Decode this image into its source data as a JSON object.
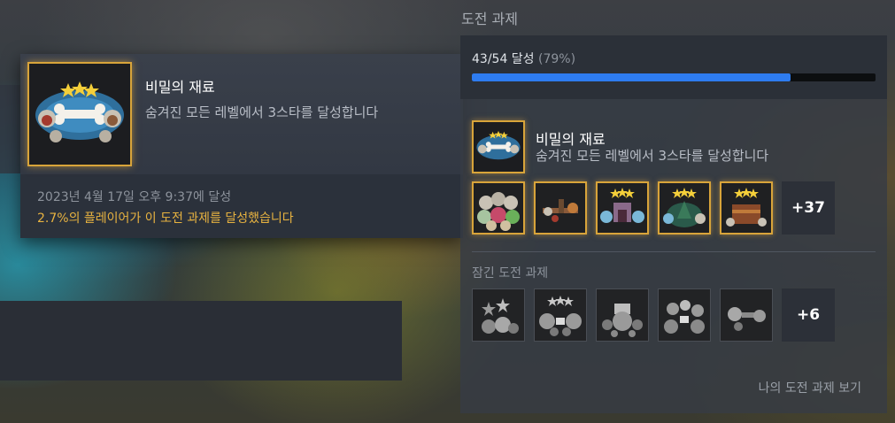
{
  "section_title": "도전 과제",
  "tooltip": {
    "title": "비밀의 재료",
    "description": "숨겨진 모든 레벨에서 3스타를 달성합니다",
    "unlock_date": "2023년 4월 17일 오후 9:37에 달성",
    "rarity": "2.7%의 플레이어가 이 도전 과제를 달성했습니다",
    "icon": "bone-three-stars-achievement-art"
  },
  "progress": {
    "count": "43/54 달성",
    "percent": "(79%)",
    "fraction": 0.79,
    "bar_color": "#2e7cf0"
  },
  "featured": {
    "title": "비밀의 재료",
    "description": "숨겨진 모든 레벨에서 3스타를 달성합니다"
  },
  "unlocked": {
    "icons": [
      "crowd-achievement-icon",
      "bridge-achievement-icon",
      "gate-three-stars-achievement-icon",
      "forest-three-stars-achievement-icon",
      "chest-three-stars-achievement-icon"
    ],
    "more": "+37"
  },
  "locked": {
    "title": "잠긴 도전 과제",
    "icons": [
      "stars-cluster-locked-icon",
      "versus-three-stars-locked-icon",
      "boss-locked-icon",
      "versus-locked-icon",
      "chef-locked-icon"
    ],
    "more": "+6"
  },
  "view_link": "나의 도전 과제 보기",
  "colors": {
    "accent_gold": "#d8a43a",
    "rarity_text": "#e8b340",
    "progress_blue": "#2e7cf0"
  }
}
